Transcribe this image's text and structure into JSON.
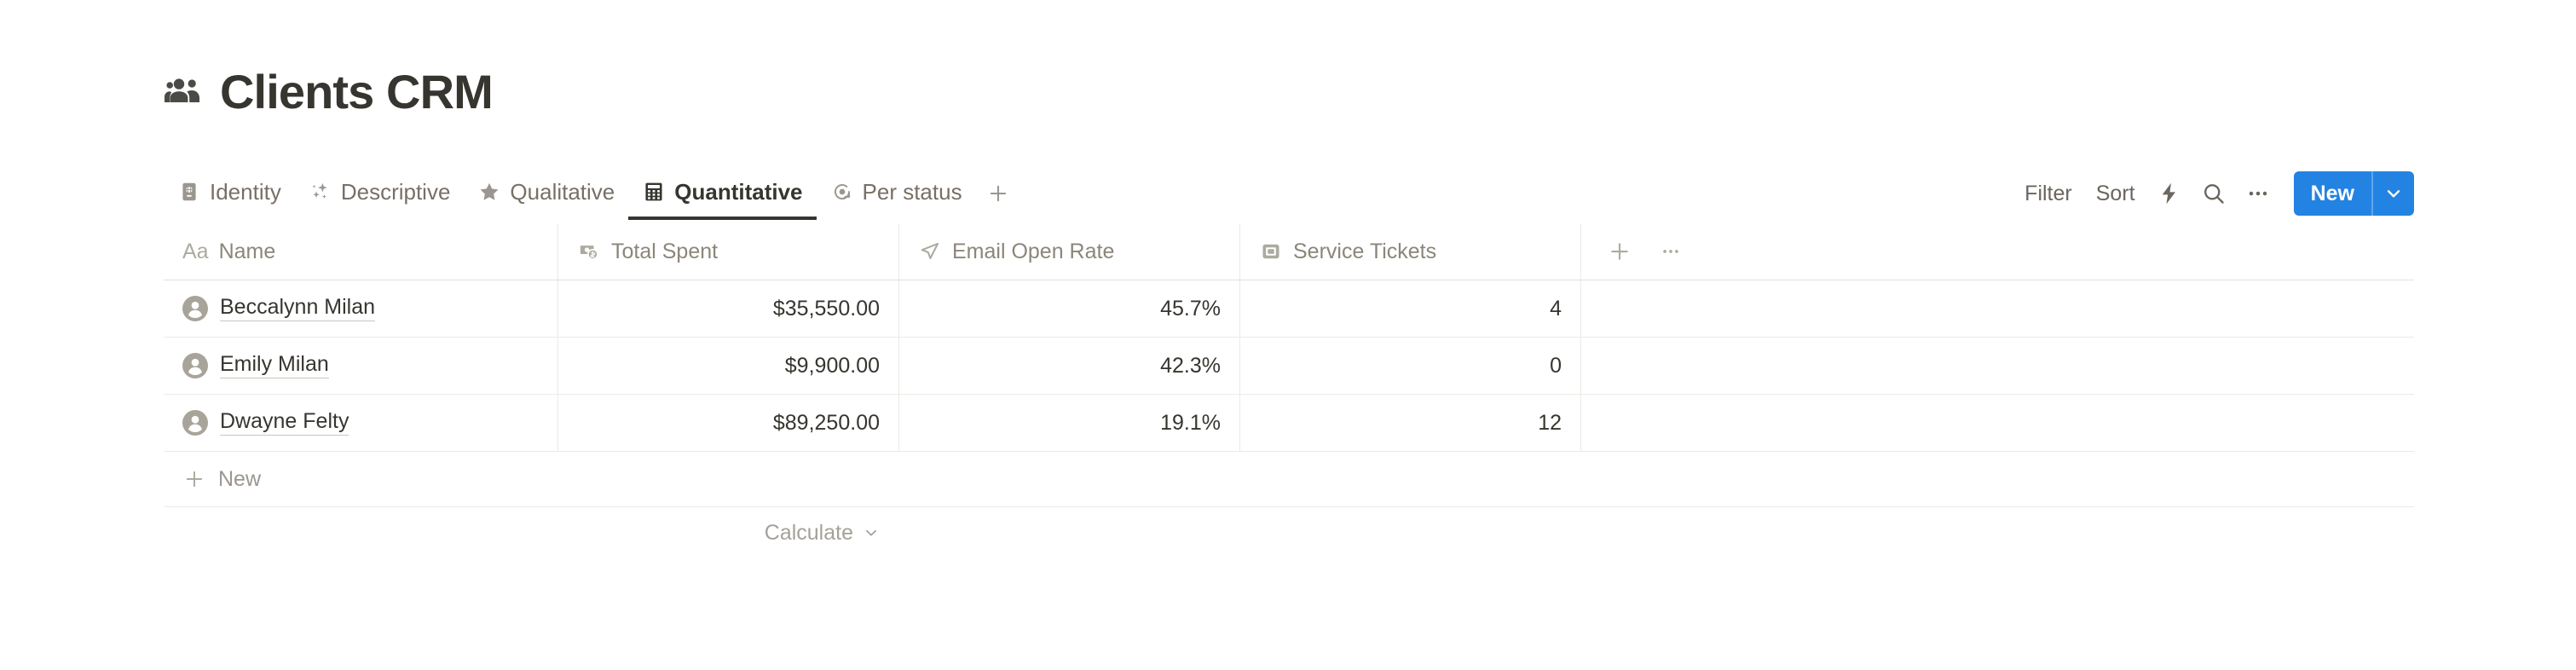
{
  "header": {
    "icon": "people-group-icon",
    "title": "Clients CRM"
  },
  "tabs": [
    {
      "label": "Identity",
      "icon": "passport-globe-icon",
      "active": false
    },
    {
      "label": "Descriptive",
      "icon": "sparkles-icon",
      "active": false
    },
    {
      "label": "Qualitative",
      "icon": "star-icon",
      "active": false
    },
    {
      "label": "Quantitative",
      "icon": "calculator-icon",
      "active": true
    },
    {
      "label": "Per status",
      "icon": "status-circle-arrow-icon",
      "active": false
    }
  ],
  "tab_add": {
    "icon": "plus-icon"
  },
  "toolbar": {
    "filter_label": "Filter",
    "sort_label": "Sort",
    "automation_icon": "lightning-bolt-icon",
    "search_icon": "search-icon",
    "more_icon": "ellipsis-icon",
    "new_label": "New",
    "new_caret_icon": "chevron-down-icon",
    "accent_color": "#2383e2"
  },
  "table": {
    "columns": [
      {
        "label": "Name",
        "icon": "title-aa-icon",
        "type": "title"
      },
      {
        "label": "Total Spent",
        "icon": "currency-icon",
        "type": "number"
      },
      {
        "label": "Email Open Rate",
        "icon": "send-arrow-icon",
        "type": "percent"
      },
      {
        "label": "Service Tickets",
        "icon": "number-box-icon",
        "type": "number"
      }
    ],
    "header_actions": [
      {
        "icon": "plus-icon"
      },
      {
        "icon": "ellipsis-icon"
      }
    ],
    "rows": [
      {
        "avatar": "person-avatar-icon",
        "name": "Beccalynn Milan",
        "total_spent": "$35,550.00",
        "email_open_rate": "45.7%",
        "service_tickets": "4"
      },
      {
        "avatar": "person-avatar-icon",
        "name": "Emily Milan",
        "total_spent": "$9,900.00",
        "email_open_rate": "42.3%",
        "service_tickets": "0"
      },
      {
        "avatar": "person-avatar-icon",
        "name": "Dwayne Felty",
        "total_spent": "$89,250.00",
        "email_open_rate": "19.1%",
        "service_tickets": "12"
      }
    ],
    "new_row_label": "New",
    "calculate_label": "Calculate"
  }
}
